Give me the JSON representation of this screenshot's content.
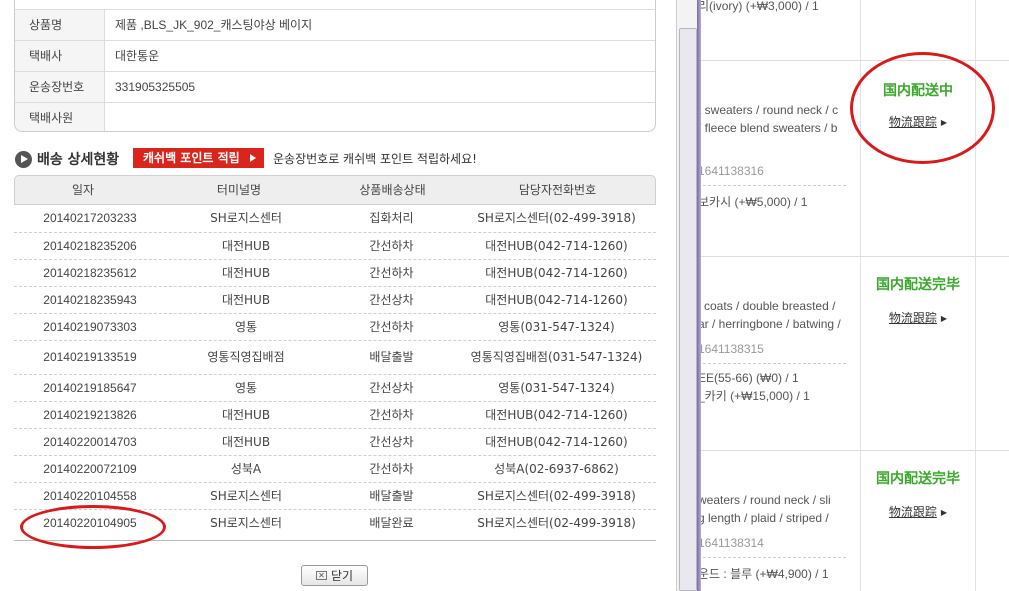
{
  "info": {
    "rows": [
      {
        "label": "상품명",
        "value": "제품 ,BLS_JK_902_캐스팅야상 베이지"
      },
      {
        "label": "택배사",
        "value": "대한통운"
      },
      {
        "label": "운송장번호",
        "value": "331905325505"
      },
      {
        "label": "택배사원",
        "value": ""
      }
    ]
  },
  "section": {
    "title": "배송 상세현황",
    "cashback_button": "캐쉬백 포인트 적립",
    "cashback_desc": "운송장번호로 캐쉬백 포인트 적립하세요!"
  },
  "table": {
    "headers": [
      "일자",
      "터미널명",
      "상품배송상태",
      "담당자전화번호"
    ],
    "rows": [
      [
        "20140217203233",
        "SH로지스센터",
        "집화처리",
        "SH로지스센터(02-499-3918)"
      ],
      [
        "20140218235206",
        "대전HUB",
        "간선하차",
        "대전HUB(042-714-1260)"
      ],
      [
        "20140218235612",
        "대전HUB",
        "간선하차",
        "대전HUB(042-714-1260)"
      ],
      [
        "20140218235943",
        "대전HUB",
        "간선상차",
        "대전HUB(042-714-1260)"
      ],
      [
        "20140219073303",
        "영통",
        "간선하차",
        "영통(031-547-1324)"
      ],
      [
        "20140219133519",
        "영통직영집배점",
        "배달출발",
        "영통직영집배점(031-547-1324)"
      ],
      [
        "20140219185647",
        "영통",
        "간선상차",
        "영통(031-547-1324)"
      ],
      [
        "20140219213826",
        "대전HUB",
        "간선하차",
        "대전HUB(042-714-1260)"
      ],
      [
        "20140220014703",
        "대전HUB",
        "간선상차",
        "대전HUB(042-714-1260)"
      ],
      [
        "20140220072109",
        "성북A",
        "간선하차",
        "성북A(02-6937-6862)"
      ],
      [
        "20140220104558",
        "SH로지스센터",
        "배달출발",
        "SH로지스센터(02-499-3918)"
      ],
      [
        "20140220104905",
        "SH로지스센터",
        "배달완료",
        "SH로지스센터(02-499-3918)"
      ]
    ]
  },
  "close_label": "닫기",
  "background": {
    "order0": {
      "line": "리(ivory) (+₩3,000) / 1"
    },
    "orders": [
      {
        "status": "国内配送中",
        "track": "物流跟踪",
        "lines": [
          "t sweaters / round neck / c",
          "/ fleece blend sweaters / b"
        ],
        "code": "1641138316",
        "option": "보카시 (+₩5,000) / 1"
      },
      {
        "status": "国内配送完毕",
        "track": "物流跟踪",
        "lines": [
          "l coats / double breasted /",
          "ar / herringbone / batwing /"
        ],
        "code": "1641138315",
        "option1": "EE(55-66) (₩0) / 1",
        "option2": "_카키 (+₩15,000) / 1"
      },
      {
        "status": "国内配送完毕",
        "track": "物流跟踪",
        "lines": [
          "weaters / round neck / sli",
          "g length / plaid / striped /"
        ],
        "code": "1641138314",
        "option": "운드 : 블루 (+₩4,900) / 1"
      }
    ]
  },
  "colors": {
    "accent_red": "#d9251c",
    "status_green": "#3aa82a",
    "annotation": "#d9191a"
  }
}
